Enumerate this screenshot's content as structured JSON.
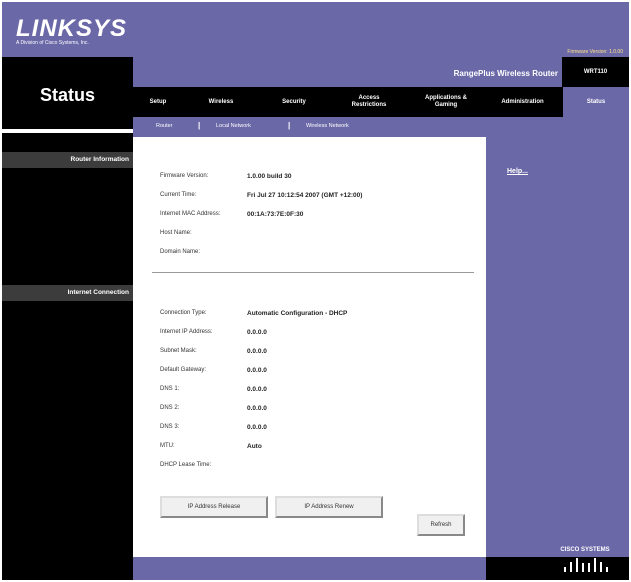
{
  "header": {
    "logo_text": "LINKSYS",
    "logo_subtext": "A Division of Cisco Systems, Inc.",
    "firmware_version": "Firmware Version: 1.0.00",
    "product_name": "RangePlus Wireless Router",
    "model": "WRT110",
    "page_title": "Status"
  },
  "nav": {
    "tabs": [
      {
        "label": "Setup"
      },
      {
        "label": "Wireless"
      },
      {
        "label": "Security"
      },
      {
        "label": "Access\nRestrictions"
      },
      {
        "label": "Applications &\nGaming"
      },
      {
        "label": "Administration"
      },
      {
        "label": "Status"
      }
    ],
    "subtabs": [
      {
        "label": "Router"
      },
      {
        "label": "Local Network"
      },
      {
        "label": "Wireless Network"
      }
    ],
    "sep": "|"
  },
  "sections": {
    "router_info": "Router Information",
    "internet_connection": "Internet Connection"
  },
  "router_info": [
    {
      "label": "Firmware Version:",
      "value": "1.0.00 build 30"
    },
    {
      "label": "Current Time:",
      "value": "Fri Jul 27 10:12:54 2007 (GMT +12:00)"
    },
    {
      "label": "Internet MAC Address:",
      "value": "00:1A:73:7E:0F:30"
    },
    {
      "label": "Host Name:",
      "value": ""
    },
    {
      "label": "Domain Name:",
      "value": ""
    }
  ],
  "internet_connection": [
    {
      "label": "Connection Type:",
      "value": "Automatic Configuration - DHCP"
    },
    {
      "label": "Internet IP Address:",
      "value": "0.0.0.0"
    },
    {
      "label": "Subnet Mask:",
      "value": "0.0.0.0"
    },
    {
      "label": "Default Gateway:",
      "value": "0.0.0.0"
    },
    {
      "label": "DNS 1:",
      "value": "0.0.0.0"
    },
    {
      "label": "DNS 2:",
      "value": "0.0.0.0"
    },
    {
      "label": "DNS 3:",
      "value": "0.0.0.0"
    },
    {
      "label": "MTU:",
      "value": "Auto"
    },
    {
      "label": "DHCP Lease Time:",
      "value": ""
    }
  ],
  "buttons": {
    "release": "IP Address Release",
    "renew": "IP Address Renew",
    "refresh": "Refresh"
  },
  "help_link": "Help...",
  "footer_logo": "CISCO SYSTEMS",
  "colors": {
    "brand_purple": "#6b68a8",
    "black": "#000000"
  }
}
